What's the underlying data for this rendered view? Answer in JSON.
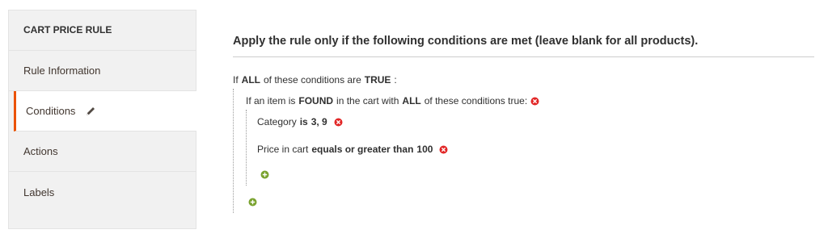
{
  "sidebar": {
    "title": "CART PRICE RULE",
    "items": [
      {
        "label": "Rule Information"
      },
      {
        "label": "Conditions"
      },
      {
        "label": "Actions"
      },
      {
        "label": "Labels"
      }
    ]
  },
  "main": {
    "fieldset_title": "Apply the rule only if the following conditions are met (leave blank for all products).",
    "root": {
      "prefix": "If",
      "aggregator": "ALL",
      "mid": "of these conditions are",
      "value": "TRUE",
      "suffix": ":"
    },
    "found": {
      "prefix": "If an item is",
      "value": "FOUND",
      "mid": "in the cart with",
      "aggregator": "ALL",
      "suffix": "of these conditions true:"
    },
    "conditions": [
      {
        "attribute": "Category",
        "operator": "is",
        "value": "3, 9"
      },
      {
        "attribute": "Price in cart",
        "operator": "equals or greater than",
        "value": "100"
      }
    ]
  },
  "colors": {
    "accent": "#eb5202",
    "remove": "#e22626",
    "add": "#79a22e"
  },
  "icons": {
    "edit": "pencil-icon",
    "remove": "remove-icon",
    "add": "add-icon"
  }
}
